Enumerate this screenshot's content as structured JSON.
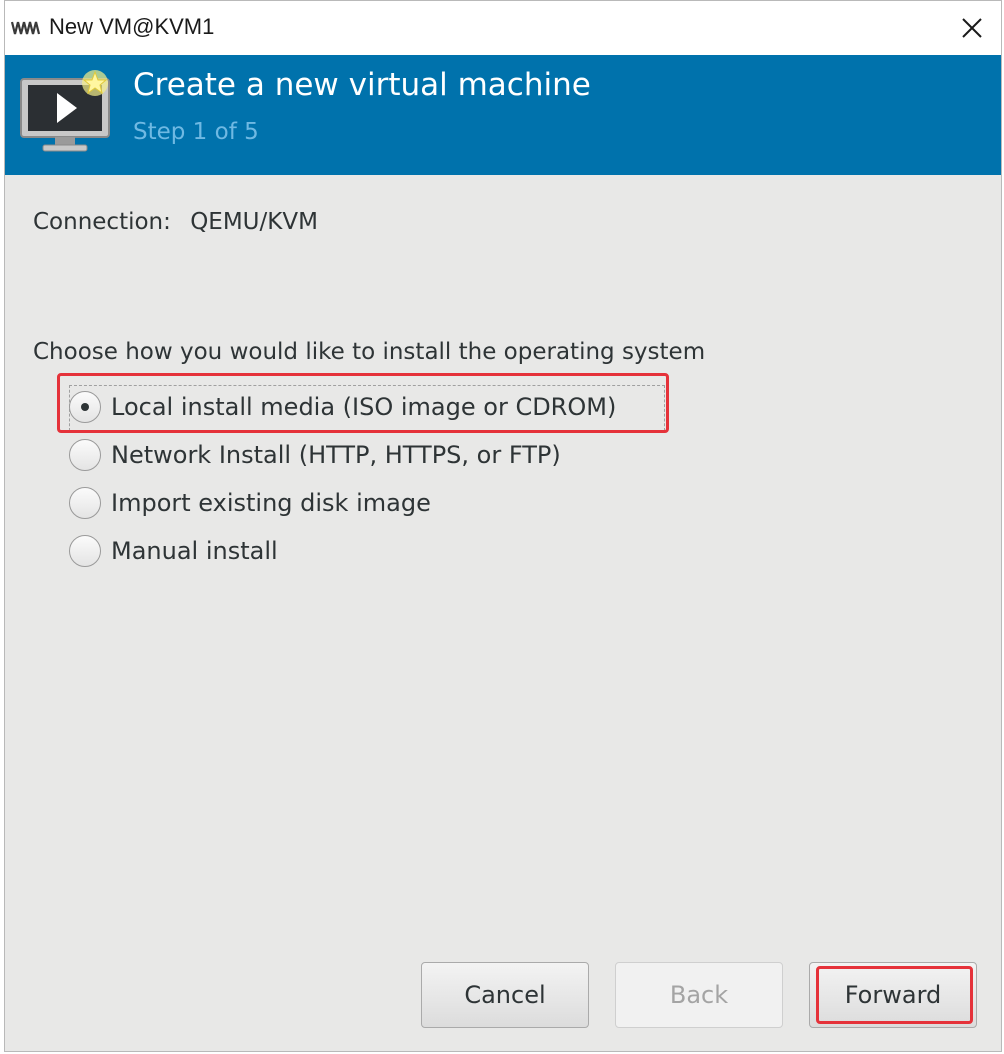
{
  "window": {
    "title": "New VM@KVM1",
    "app_icon": "virt-manager-logo-icon",
    "close_icon": "close-icon"
  },
  "banner": {
    "title": "Create a new virtual machine",
    "step": "Step 1 of 5",
    "icon": "new-vm-monitor-icon",
    "background_color": "#0072ac"
  },
  "connection": {
    "label": "Connection:",
    "value": "QEMU/KVM"
  },
  "install": {
    "prompt": "Choose how you would like to install the operating system",
    "options": [
      {
        "label": "Local install media (ISO image or CDROM)",
        "checked": true
      },
      {
        "label": "Network Install (HTTP, HTTPS, or FTP)",
        "checked": false
      },
      {
        "label": "Import existing disk image",
        "checked": false
      },
      {
        "label": "Manual install",
        "checked": false
      }
    ]
  },
  "buttons": {
    "cancel": "Cancel",
    "back": "Back",
    "forward": "Forward"
  },
  "colors": {
    "highlight": "#e5323a",
    "banner": "#0072ac",
    "step_text": "#6fb9e3"
  }
}
